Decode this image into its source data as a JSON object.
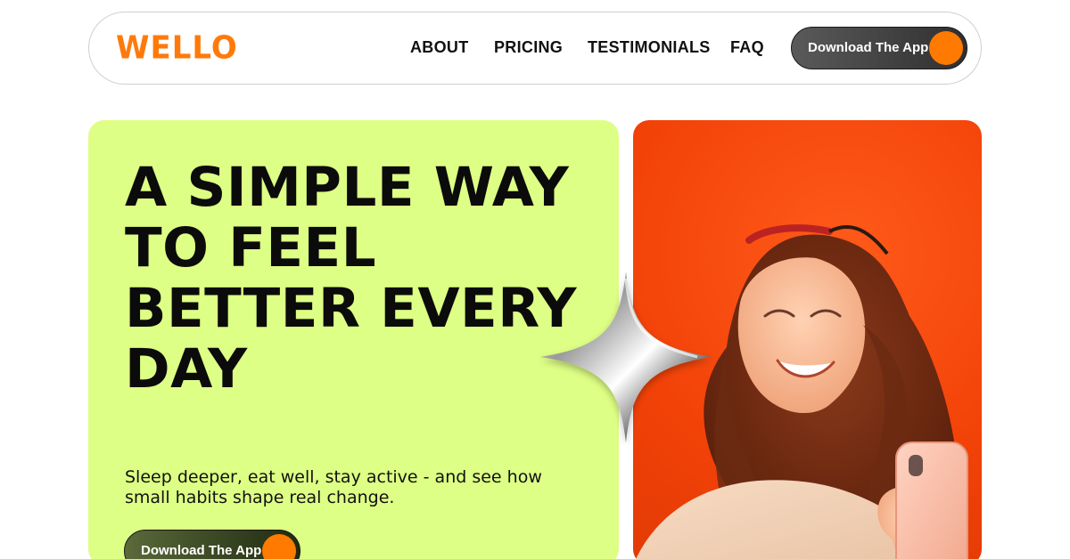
{
  "brand": {
    "logo_text": "WELLO",
    "accent": "#ff7a00",
    "hero_bg": "#deff85",
    "photo_bg": "#f24208"
  },
  "nav": {
    "items": [
      {
        "label": "ABOUT"
      },
      {
        "label": "PRICING"
      },
      {
        "label": "TESTIMONIALS"
      },
      {
        "label": "FAQ"
      }
    ],
    "cta_label": "Download The App"
  },
  "hero": {
    "headline_lines": [
      "A SIMPLE WAY",
      "TO FEEL",
      "BETTER EVERY",
      "DAY"
    ],
    "subtext": "Sleep deeper, eat well, stay active - and see how small habits shape real change.",
    "cta_label": "Download The App"
  },
  "icons": {
    "decor": "sparkle-icon"
  }
}
